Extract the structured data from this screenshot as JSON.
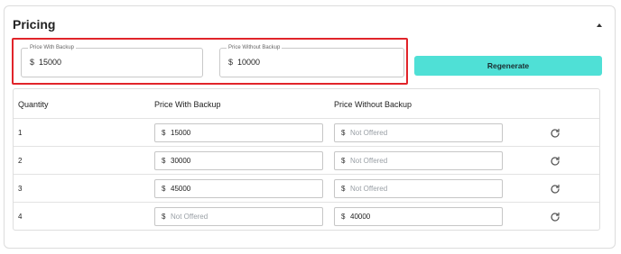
{
  "card": {
    "title": "Pricing",
    "collapse_icon": "chevron-up-icon"
  },
  "top_fields": {
    "with_backup": {
      "legend": "Price With Backup",
      "prefix": "$",
      "value": "15000"
    },
    "without_backup": {
      "legend": "Price Without Backup",
      "prefix": "$",
      "value": "10000"
    }
  },
  "regenerate_label": "Regenerate",
  "colors": {
    "accent": "#4fe0d6",
    "highlight": "#e1242a",
    "placeholder": "#9aa0a6"
  },
  "table": {
    "headers": [
      "Quantity",
      "Price With Backup",
      "Price Without Backup"
    ],
    "rows": [
      {
        "quantity": "1",
        "with_backup": {
          "prefix": "$",
          "value": "15000",
          "is_placeholder": false
        },
        "without_backup": {
          "prefix": "$",
          "value": "Not Offered",
          "is_placeholder": true
        },
        "action_icon": "refresh-icon"
      },
      {
        "quantity": "2",
        "with_backup": {
          "prefix": "$",
          "value": "30000",
          "is_placeholder": false
        },
        "without_backup": {
          "prefix": "$",
          "value": "Not Offered",
          "is_placeholder": true
        },
        "action_icon": "refresh-icon"
      },
      {
        "quantity": "3",
        "with_backup": {
          "prefix": "$",
          "value": "45000",
          "is_placeholder": false
        },
        "without_backup": {
          "prefix": "$",
          "value": "Not Offered",
          "is_placeholder": true
        },
        "action_icon": "refresh-icon"
      },
      {
        "quantity": "4",
        "with_backup": {
          "prefix": "$",
          "value": "Not Offered",
          "is_placeholder": true
        },
        "without_backup": {
          "prefix": "$",
          "value": "40000",
          "is_placeholder": false
        },
        "action_icon": "refresh-icon"
      }
    ]
  }
}
